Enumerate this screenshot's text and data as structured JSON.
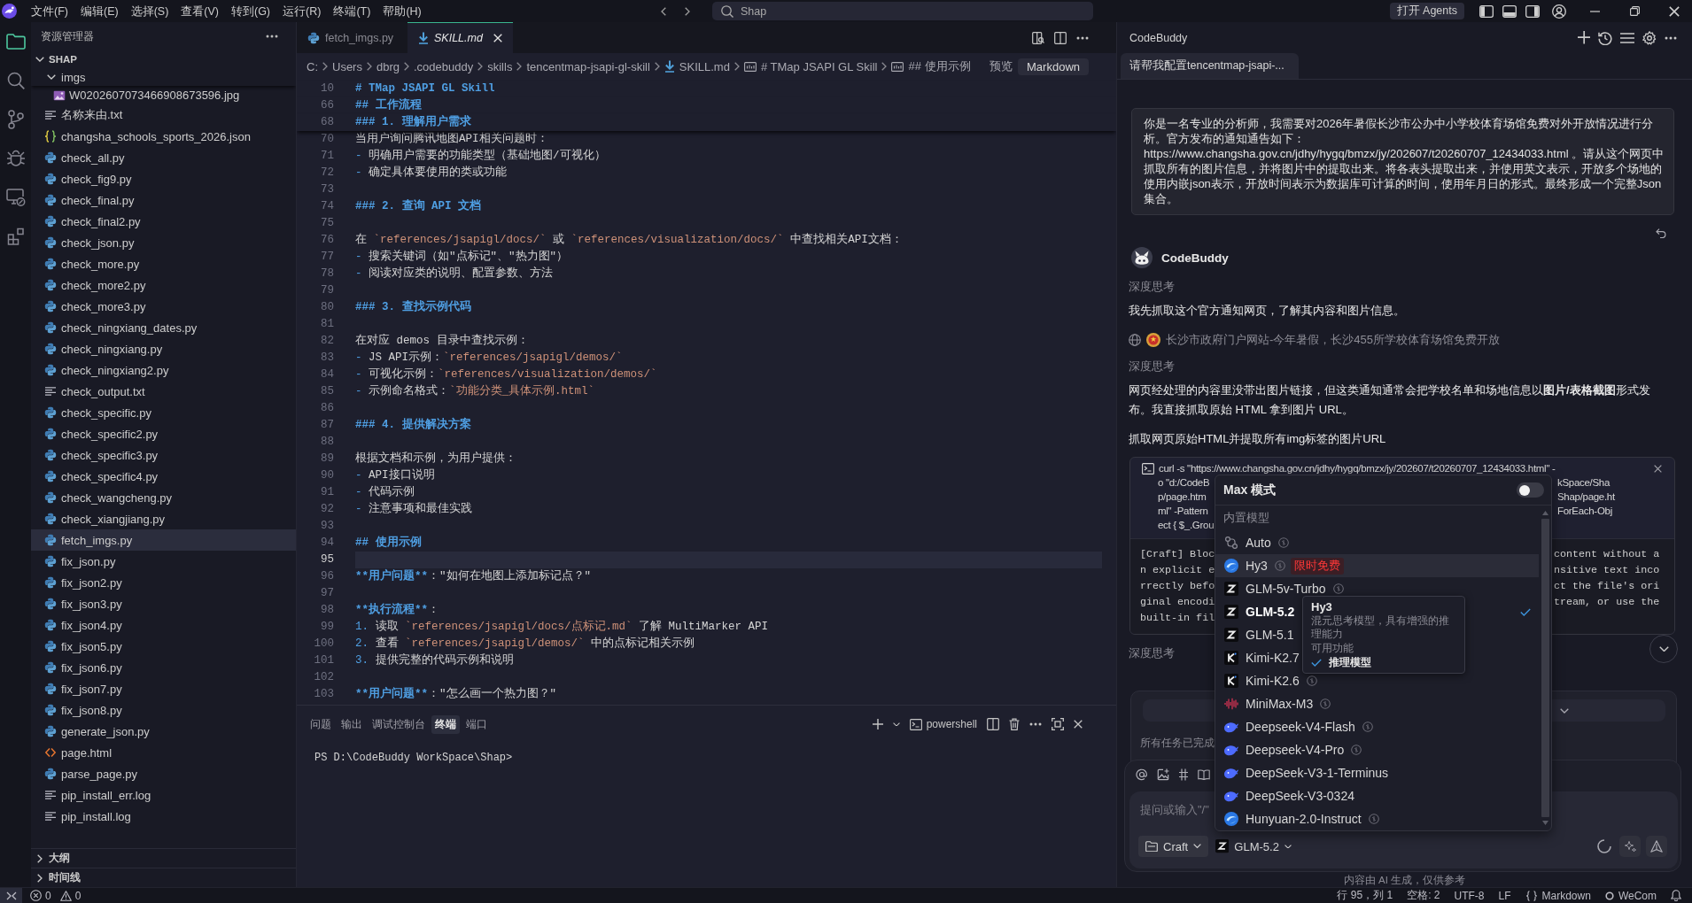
{
  "title_bar": {
    "menus": [
      "文件(F)",
      "编辑(E)",
      "选择(S)",
      "查看(V)",
      "转到(G)",
      "运行(R)",
      "终端(T)",
      "帮助(H)"
    ],
    "search": {
      "value": "Shap"
    },
    "agents_button": "打开 Agents"
  },
  "activity_bar": [
    {
      "kind": "files",
      "selected": true
    },
    {
      "kind": "search",
      "selected": false
    },
    {
      "kind": "source-control",
      "selected": false
    },
    {
      "kind": "debug",
      "selected": false
    },
    {
      "kind": "remote",
      "selected": false
    },
    {
      "kind": "extensions",
      "selected": false
    }
  ],
  "explorer": {
    "title": "资源管理器",
    "root": {
      "name": "SHAP",
      "expanded": true
    },
    "items": [
      {
        "name": "imgs",
        "kind": "folder",
        "expanded": true,
        "selected": false,
        "children": [
          {
            "name": "W0202607073466908673596.jpg",
            "kind": "image",
            "selected": false
          }
        ]
      },
      {
        "name": "名称来由.txt",
        "kind": "text",
        "selected": false
      },
      {
        "name": "changsha_schools_sports_2026.json",
        "kind": "json",
        "selected": false
      },
      {
        "name": "check_all.py",
        "kind": "python",
        "selected": false
      },
      {
        "name": "check_fig9.py",
        "kind": "python",
        "selected": false
      },
      {
        "name": "check_final.py",
        "kind": "python",
        "selected": false
      },
      {
        "name": "check_final2.py",
        "kind": "python",
        "selected": false
      },
      {
        "name": "check_json.py",
        "kind": "python",
        "selected": false
      },
      {
        "name": "check_more.py",
        "kind": "python",
        "selected": false
      },
      {
        "name": "check_more2.py",
        "kind": "python",
        "selected": false
      },
      {
        "name": "check_more3.py",
        "kind": "python",
        "selected": false
      },
      {
        "name": "check_ningxiang_dates.py",
        "kind": "python",
        "selected": false
      },
      {
        "name": "check_ningxiang.py",
        "kind": "python",
        "selected": false
      },
      {
        "name": "check_ningxiang2.py",
        "kind": "python",
        "selected": false
      },
      {
        "name": "check_output.txt",
        "kind": "text",
        "selected": false
      },
      {
        "name": "check_specific.py",
        "kind": "python",
        "selected": false
      },
      {
        "name": "check_specific2.py",
        "kind": "python",
        "selected": false
      },
      {
        "name": "check_specific3.py",
        "kind": "python",
        "selected": false
      },
      {
        "name": "check_specific4.py",
        "kind": "python",
        "selected": false
      },
      {
        "name": "check_wangcheng.py",
        "kind": "python",
        "selected": false
      },
      {
        "name": "check_xiangjiang.py",
        "kind": "python",
        "selected": false
      },
      {
        "name": "fetch_imgs.py",
        "kind": "python",
        "selected": true
      },
      {
        "name": "fix_json.py",
        "kind": "python",
        "selected": false
      },
      {
        "name": "fix_json2.py",
        "kind": "python",
        "selected": false
      },
      {
        "name": "fix_json3.py",
        "kind": "python",
        "selected": false
      },
      {
        "name": "fix_json4.py",
        "kind": "python",
        "selected": false
      },
      {
        "name": "fix_json5.py",
        "kind": "python",
        "selected": false
      },
      {
        "name": "fix_json6.py",
        "kind": "python",
        "selected": false
      },
      {
        "name": "fix_json7.py",
        "kind": "python",
        "selected": false
      },
      {
        "name": "fix_json8.py",
        "kind": "python",
        "selected": false
      },
      {
        "name": "generate_json.py",
        "kind": "python",
        "selected": false
      },
      {
        "name": "page.html",
        "kind": "html",
        "selected": false
      },
      {
        "name": "parse_page.py",
        "kind": "python",
        "selected": false
      },
      {
        "name": "pip_install_err.log",
        "kind": "text",
        "selected": false
      },
      {
        "name": "pip_install.log",
        "kind": "text",
        "selected": false
      }
    ],
    "sections": [
      {
        "title": "大纲",
        "expanded": false
      },
      {
        "title": "时间线",
        "expanded": false
      }
    ]
  },
  "editor": {
    "tabs": [
      {
        "label": "fetch_imgs.py",
        "kind": "python",
        "selected": false,
        "preview": false
      },
      {
        "label": "SKILL.md",
        "kind": "markdown",
        "selected": true,
        "preview": true
      }
    ],
    "breadcrumbs": [
      {
        "label": "C:",
        "kind": "path"
      },
      {
        "label": "Users",
        "kind": "path"
      },
      {
        "label": "dbrg",
        "kind": "path"
      },
      {
        "label": ".codebuddy",
        "kind": "path"
      },
      {
        "label": "skills",
        "kind": "path"
      },
      {
        "label": "tencentmap-jsapi-gl-skill",
        "kind": "path"
      },
      {
        "label": "SKILL.md",
        "kind": "markdown"
      },
      {
        "label": "# TMap JSAPI GL Skill",
        "kind": "symbol"
      },
      {
        "label": "## 使用示例",
        "kind": "symbol"
      }
    ],
    "preview_button": "预览",
    "language_button": "Markdown",
    "sticky_lines": [
      {
        "number": "10",
        "segments": [
          {
            "kind": "heading",
            "text": "# TMap JSAPI GL Skill"
          }
        ]
      },
      {
        "number": "66",
        "segments": [
          {
            "kind": "heading",
            "text": "## 工作流程"
          }
        ]
      },
      {
        "number": "68",
        "segments": [
          {
            "kind": "heading",
            "text": "### 1. 理解用户需求"
          }
        ]
      }
    ],
    "lines": [
      {
        "number": "70",
        "current": false,
        "segments": [
          {
            "kind": "text",
            "text": "当用户询问腾讯地图API相关问题时："
          }
        ]
      },
      {
        "number": "71",
        "current": false,
        "segments": [
          {
            "kind": "marker",
            "text": "- "
          },
          {
            "kind": "text",
            "text": "明确用户需要的功能类型（基础地图/可视化）"
          }
        ]
      },
      {
        "number": "72",
        "current": false,
        "segments": [
          {
            "kind": "marker",
            "text": "- "
          },
          {
            "kind": "text",
            "text": "确定具体要使用的类或功能"
          }
        ]
      },
      {
        "number": "73",
        "current": false
      },
      {
        "number": "74",
        "current": false,
        "segments": [
          {
            "kind": "heading",
            "text": "### 2. 查询 API 文档"
          }
        ]
      },
      {
        "number": "75",
        "current": false
      },
      {
        "number": "76",
        "current": false,
        "segments": [
          {
            "kind": "text",
            "text": "在 "
          },
          {
            "kind": "code",
            "text": "`references/jsapigl/docs/`"
          },
          {
            "kind": "text",
            "text": " 或 "
          },
          {
            "kind": "code",
            "text": "`references/visualization/docs/`"
          },
          {
            "kind": "text",
            "text": " 中查找相关API文档："
          }
        ]
      },
      {
        "number": "77",
        "current": false,
        "segments": [
          {
            "kind": "marker",
            "text": "- "
          },
          {
            "kind": "text",
            "text": "搜索关键词（如\"点标记\"、\"热力图\"）"
          }
        ]
      },
      {
        "number": "78",
        "current": false,
        "segments": [
          {
            "kind": "marker",
            "text": "- "
          },
          {
            "kind": "text",
            "text": "阅读对应类的说明、配置参数、方法"
          }
        ]
      },
      {
        "number": "79",
        "current": false
      },
      {
        "number": "80",
        "current": false,
        "segments": [
          {
            "kind": "heading",
            "text": "### 3. 查找示例代码"
          }
        ]
      },
      {
        "number": "81",
        "current": false
      },
      {
        "number": "82",
        "current": false,
        "segments": [
          {
            "kind": "text",
            "text": "在对应 demos 目录中查找示例："
          }
        ]
      },
      {
        "number": "83",
        "current": false,
        "segments": [
          {
            "kind": "marker",
            "text": "- "
          },
          {
            "kind": "text",
            "text": "JS API示例："
          },
          {
            "kind": "code",
            "text": "`references/jsapigl/demos/`"
          }
        ]
      },
      {
        "number": "84",
        "current": false,
        "segments": [
          {
            "kind": "marker",
            "text": "- "
          },
          {
            "kind": "text",
            "text": "可视化示例："
          },
          {
            "kind": "code",
            "text": "`references/visualization/demos/`"
          }
        ]
      },
      {
        "number": "85",
        "current": false,
        "segments": [
          {
            "kind": "marker",
            "text": "- "
          },
          {
            "kind": "text",
            "text": "示例命名格式："
          },
          {
            "kind": "code",
            "text": "`功能分类_具体示例.html`"
          }
        ]
      },
      {
        "number": "86",
        "current": false
      },
      {
        "number": "87",
        "current": false,
        "segments": [
          {
            "kind": "heading",
            "text": "### 4. 提供解决方案"
          }
        ]
      },
      {
        "number": "88",
        "current": false
      },
      {
        "number": "89",
        "current": false,
        "segments": [
          {
            "kind": "text",
            "text": "根据文档和示例，为用户提供："
          }
        ]
      },
      {
        "number": "90",
        "current": false,
        "segments": [
          {
            "kind": "marker",
            "text": "- "
          },
          {
            "kind": "text",
            "text": "API接口说明"
          }
        ]
      },
      {
        "number": "91",
        "current": false,
        "segments": [
          {
            "kind": "marker",
            "text": "- "
          },
          {
            "kind": "text",
            "text": "代码示例"
          }
        ]
      },
      {
        "number": "92",
        "current": false,
        "segments": [
          {
            "kind": "marker",
            "text": "- "
          },
          {
            "kind": "text",
            "text": "注意事项和最佳实践"
          }
        ]
      },
      {
        "number": "93",
        "current": false
      },
      {
        "number": "94",
        "current": false,
        "segments": [
          {
            "kind": "heading",
            "text": "## 使用示例"
          }
        ]
      },
      {
        "number": "95",
        "current": true
      },
      {
        "number": "96",
        "current": false,
        "segments": [
          {
            "kind": "bold",
            "text": "**用户问题**"
          },
          {
            "kind": "text",
            "text": "：\"如何在地图上添加标记点？\""
          }
        ]
      },
      {
        "number": "97",
        "current": false
      },
      {
        "number": "98",
        "current": false,
        "segments": [
          {
            "kind": "bold",
            "text": "**执行流程**"
          },
          {
            "kind": "text",
            "text": "："
          }
        ]
      },
      {
        "number": "99",
        "current": false,
        "segments": [
          {
            "kind": "marker",
            "text": "1. "
          },
          {
            "kind": "text",
            "text": "读取 "
          },
          {
            "kind": "code",
            "text": "`references/jsapigl/docs/点标记.md`"
          },
          {
            "kind": "text",
            "text": " 了解 MultiMarker API"
          }
        ]
      },
      {
        "number": "100",
        "current": false,
        "segments": [
          {
            "kind": "marker",
            "text": "2. "
          },
          {
            "kind": "text",
            "text": "查看 "
          },
          {
            "kind": "code",
            "text": "`references/jsapigl/demos/`"
          },
          {
            "kind": "text",
            "text": " 中的点标记相关示例"
          }
        ]
      },
      {
        "number": "101",
        "current": false,
        "segments": [
          {
            "kind": "marker",
            "text": "3. "
          },
          {
            "kind": "text",
            "text": "提供完整的代码示例和说明"
          }
        ]
      },
      {
        "number": "102",
        "current": false
      },
      {
        "number": "103",
        "current": false,
        "segments": [
          {
            "kind": "bold",
            "text": "**用户问题**"
          },
          {
            "kind": "text",
            "text": "：\"怎么画一个热力图？\""
          }
        ]
      }
    ]
  },
  "panel": {
    "tabs": [
      {
        "label": "问题",
        "selected": false
      },
      {
        "label": "输出",
        "selected": false
      },
      {
        "label": "调试控制台",
        "selected": false
      },
      {
        "label": "终端",
        "selected": true
      },
      {
        "label": "端口",
        "selected": false
      }
    ],
    "shell": "powershell",
    "prompt": "PS D:\\CodeBuddy WorkSpace\\Shap>"
  },
  "assistant": {
    "title": "CodeBuddy",
    "tabs": [
      {
        "label": "请帮我配置tencentmap-jsapi-...",
        "selected": true
      }
    ],
    "user_message": "你是一名专业的分析师，我需要对2026年暑假长沙市公办中小学校体育场馆免费对外开放情况进行分析。官方发布的通知通告如下：https://www.changsha.gov.cn/jdhy/hygq/bmzx/jy/202607/t20260707_12434033.html 。请从这个网页中抓取所有的图片信息，并将图片中的提取出来。将各表头提取出来，并使用英文表示，开放多个场地的使用内嵌json表示，开放时间表示为数据库可计算的时间，使用年月日的形式。最终形成一个完整Json集合。",
    "bot_name": "CodeBuddy",
    "messages": [
      {
        "kind": "thinking",
        "text": "深度思考"
      },
      {
        "kind": "text",
        "text": "我先抓取这个官方通知网页，了解其内容和图片信息。"
      },
      {
        "kind": "source",
        "text": "长沙市政府门户网站-今年暑假，长沙455所学校体育场馆免费开放"
      },
      {
        "kind": "thinking",
        "text": "深度思考"
      },
      {
        "kind": "text",
        "text": "网页经处理的内容里没带出图片链接，但这类通知通常会把学校名单和场地信息以**图片/表格截图**形式发布。我直接抓取原始 HTML 拿到图片 URL。"
      },
      {
        "kind": "text",
        "text": "抓取网页原始HTML并提取所有img标签的图片URL"
      },
      {
        "kind": "command",
        "command": [
          {
            "left": "curl -s \"https://www.changsha.gov.cn/jdhy/hygq/bmzx/jy/202607/t20260707_12434033.html\" -"
          },
          {
            "left": "o \"d:/CodeB",
            "right": "kSpace/Sha"
          },
          {
            "left": "p/page.htm",
            "right": "Shap/page.ht"
          },
          {
            "left": "ml\" -Pattern",
            "right": "ForEach-Obj"
          },
          {
            "left": "ect { $_.Grou"
          }
        ],
        "output": [
          {
            "left": "[Craft] Bloc",
            "right": "content without a"
          },
          {
            "left": "n explicit e",
            "right": "nsitive text inco"
          },
          {
            "left": "rrectly befo",
            "right": "ct the file's ori"
          },
          {
            "left": "ginal encodi",
            "right": "tream, or use the"
          },
          {
            "left": "built-in fil"
          }
        ]
      },
      {
        "kind": "thinking",
        "text": "深度思考"
      }
    ],
    "task_status": "所有任务已完成",
    "input": {
      "placeholder": "提问或输入\"/\"",
      "mode": "Craft",
      "model": "GLM-5.2"
    },
    "disclaimer": "内容由 AI 生成，仅供参考",
    "model_menu": {
      "max_mode": {
        "label": "Max 模式",
        "on": false
      },
      "section": "内置模型",
      "items": [
        {
          "name": "Auto",
          "kind": "auto",
          "info_icon": true,
          "highlighted": false,
          "selected": false
        },
        {
          "name": "Hy3",
          "kind": "sphere",
          "info_icon": true,
          "badge": "限时免费",
          "highlighted": true,
          "selected": false
        },
        {
          "name": "GLM-5v-Turbo",
          "kind": "z",
          "info_icon": true,
          "highlighted": false,
          "selected": false
        },
        {
          "name": "GLM-5.2",
          "kind": "z",
          "info_icon": false,
          "highlighted": false,
          "selected": true
        },
        {
          "name": "GLM-5.1",
          "kind": "z",
          "info_icon": false,
          "highlighted": false,
          "selected": false
        },
        {
          "name": "Kimi-K2.7",
          "kind": "k",
          "info_icon": false,
          "highlighted": false,
          "selected": false
        },
        {
          "name": "Kimi-K2.6",
          "kind": "k",
          "info_icon": true,
          "highlighted": false,
          "selected": false
        },
        {
          "name": "MiniMax-M3",
          "kind": "wave",
          "info_icon": true,
          "highlighted": false,
          "selected": false
        },
        {
          "name": "Deepseek-V4-Flash",
          "kind": "whale",
          "info_icon": true,
          "highlighted": false,
          "selected": false
        },
        {
          "name": "Deepseek-V4-Pro",
          "kind": "whale",
          "info_icon": true,
          "highlighted": false,
          "selected": false
        },
        {
          "name": "DeepSeek-V3-1-Terminus",
          "kind": "whale",
          "info_icon": false,
          "highlighted": false,
          "selected": false
        },
        {
          "name": "DeepSeek-V3-0324",
          "kind": "whale",
          "info_icon": false,
          "highlighted": false,
          "selected": false
        },
        {
          "name": "Hunyuan-2.0-Instruct",
          "kind": "sphere",
          "info_icon": true,
          "highlighted": false,
          "selected": false
        }
      ],
      "tooltip": {
        "title": "Hy3",
        "description": "混元思考模型，具有增强的推理能力",
        "features_label": "可用功能",
        "features": [
          "推理模型"
        ]
      }
    }
  },
  "status_bar": {
    "errors": "0",
    "warnings": "0",
    "items": [
      {
        "kind": "plain",
        "text": "行 95，列 1"
      },
      {
        "kind": "plain",
        "text": "空格: 2"
      },
      {
        "kind": "plain",
        "text": "UTF-8"
      },
      {
        "kind": "plain",
        "text": "LF"
      },
      {
        "kind": "language",
        "text": "Markdown"
      },
      {
        "kind": "account",
        "text": "WeCom"
      }
    ]
  }
}
